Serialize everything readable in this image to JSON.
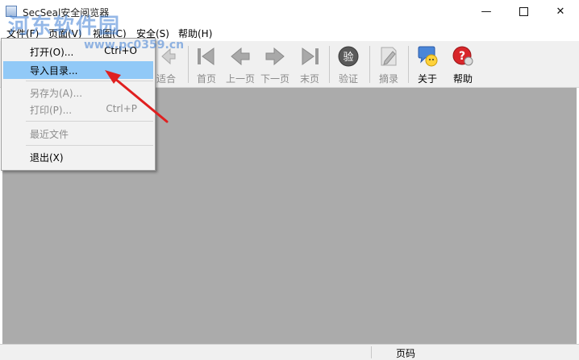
{
  "window": {
    "title": "SecSeal安全阅览器"
  },
  "title_controls": {
    "minimize": "—",
    "close": "✕"
  },
  "menu": {
    "items": [
      "文件(F)",
      "页面(V)",
      "视图(C)",
      "安全(S)",
      "帮助(H)"
    ]
  },
  "toolbar": {
    "buttons": [
      {
        "label": "适合",
        "icon": "fit-arrow-icon",
        "enabled": false
      },
      {
        "label": "首页",
        "icon": "first-page-icon",
        "enabled": false
      },
      {
        "label": "上一页",
        "icon": "prev-page-icon",
        "enabled": false
      },
      {
        "label": "下一页",
        "icon": "next-page-icon",
        "enabled": false
      },
      {
        "label": "末页",
        "icon": "last-page-icon",
        "enabled": false
      },
      {
        "label": "验证",
        "icon": "verify-icon",
        "enabled": false
      },
      {
        "label": "摘录",
        "icon": "excerpt-icon",
        "enabled": false
      },
      {
        "label": "关于",
        "icon": "about-icon",
        "enabled": true
      },
      {
        "label": "帮助",
        "icon": "help-icon",
        "enabled": true
      }
    ],
    "verify_glyph": "验"
  },
  "file_menu": {
    "open": {
      "label": "打开(O)...",
      "shortcut": "Ctrl+O"
    },
    "import": {
      "label": "导入目录..."
    },
    "save_as": {
      "label": "另存为(A)..."
    },
    "print": {
      "label": "打印(P)...",
      "shortcut": "Ctrl+P"
    },
    "recent": {
      "label": "最近文件"
    },
    "exit": {
      "label": "退出(X)"
    }
  },
  "statusbar": {
    "page_label": "页码"
  },
  "watermark": {
    "line1": "河东软件园",
    "line2": "www.pc0359.cn"
  },
  "colors": {
    "highlight": "#91c9f7",
    "doc_background": "#ababab",
    "arrow": "#e02020"
  }
}
